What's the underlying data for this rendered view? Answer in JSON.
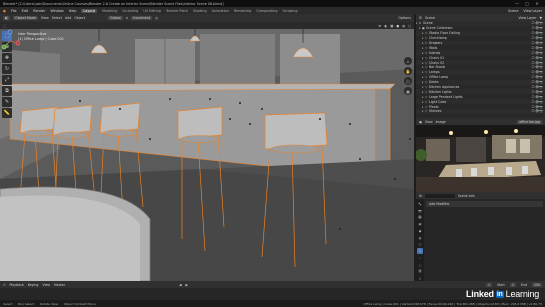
{
  "titlebar": {
    "title": "Blender* [C:\\Users\\user\\Documents\\Online Courses\\Blender 2.8 Create an Interior Scene\\Blender Scene Files\\Interior Scene 08.blend]",
    "minimize": "—",
    "maximize": "□",
    "close": "✕"
  },
  "menubar": {
    "menus": [
      "File",
      "Edit",
      "Render",
      "Window",
      "Help"
    ],
    "workspaces": [
      "Layout",
      "Modeling",
      "Sculpting",
      "UV Editing",
      "Texture Paint",
      "Shading",
      "Animation",
      "Rendering",
      "Compositing",
      "Scripting"
    ],
    "active_workspace": "Layout",
    "scene": "Scene",
    "view_layer": "View Layer"
  },
  "viewport_header": {
    "mode": "Object Mode",
    "menus": [
      "View",
      "Select",
      "Add",
      "Object"
    ],
    "transform": "Global",
    "snap": "Increment",
    "options": "Options"
  },
  "viewport_info": {
    "view": "User Perspective",
    "collection": "(1) Office Lamp | Cube.001"
  },
  "toolbar": {
    "tools": [
      "select-icon",
      "cursor-icon",
      "move-icon",
      "rotate-icon",
      "scale-icon",
      "transform-icon",
      "annotate-icon",
      "measure-icon"
    ]
  },
  "gizmo": {
    "x": "X",
    "y": "Y",
    "z": "Z"
  },
  "outliner": {
    "header_label": "Scene",
    "view_layer": "View Layer",
    "rows": [
      {
        "name": "Scene",
        "icon": "S",
        "color": "#d0d0d0"
      },
      {
        "name": "Scene Collection",
        "icon": "▣",
        "color": "#d0d0d0"
      },
      {
        "name": "Stadio Floor Ceiling",
        "icon": "▽",
        "color": "#e0a060"
      },
      {
        "name": "Checklamp",
        "icon": "▽",
        "color": "#e0a060"
      },
      {
        "name": "Drawers",
        "icon": "▽",
        "color": "#e0a060"
      },
      {
        "name": "Walls",
        "icon": "▽",
        "color": "#e0a060"
      },
      {
        "name": "Islands",
        "icon": "▽",
        "color": "#e0a060"
      },
      {
        "name": "Chairs 01",
        "icon": "▽",
        "color": "#e0a060"
      },
      {
        "name": "Chairs 02",
        "icon": "▽",
        "color": "#e0a060"
      },
      {
        "name": "Bar Stools",
        "icon": "▽",
        "color": "#e0a060"
      },
      {
        "name": "Lamps",
        "icon": "▽",
        "color": "#e0a060"
      },
      {
        "name": "Office Lamp",
        "icon": "▽",
        "color": "#e0a060"
      },
      {
        "name": "Desks",
        "icon": "▽",
        "color": "#e0a060"
      },
      {
        "name": "Kitchen Appliances",
        "icon": "▽",
        "color": "#e0a060"
      },
      {
        "name": "Kitchen Lights",
        "icon": "▽",
        "color": "#e0a060"
      },
      {
        "name": "Large Pendant Lights",
        "icon": "▽",
        "color": "#e0a060"
      },
      {
        "name": "Light Cube",
        "icon": "▽",
        "color": "#e0a060"
      },
      {
        "name": "Plants",
        "icon": "▽",
        "color": "#e0a060"
      },
      {
        "name": "Shelves",
        "icon": "▽",
        "color": "#e0a060"
      }
    ]
  },
  "preview_header": {
    "menus": [
      "View",
      "Image"
    ],
    "image_name": "office bar.jpg"
  },
  "properties_header": {
    "search_placeholder": "",
    "object_label": "Scene Info"
  },
  "properties": {
    "panel": "Add Modifier",
    "tabs": [
      "tool-icon",
      "render-icon",
      "output-icon",
      "view-layer-icon",
      "scene-icon",
      "world-icon",
      "object-icon",
      "modifier-icon",
      "particles-icon",
      "physics-icon",
      "constraints-icon",
      "data-icon",
      "material-icon"
    ]
  },
  "timeline": {
    "menus": [
      "Playback",
      "Keying",
      "View",
      "Marker"
    ],
    "current_frame": "1",
    "start_label": "Start",
    "start": "1",
    "end_label": "End",
    "end": "250"
  },
  "statusbar": {
    "items": [
      "Select",
      "Box Select",
      "Rotate View",
      "Object Context Menu"
    ],
    "stats": "Office Lamp | Cube.001 | Verts:0/198,578 | Faces:0/190,240 | Tris:381,488 | Objects:1/168 | Mem: 205.2 MiB | v2.80.75"
  },
  "watermark": {
    "brand": "Linked",
    "badge": "in",
    "suffix": "Learning"
  },
  "colors": {
    "accent": "#4772b3",
    "selection_outline": "#e8822a",
    "viewport_bg": "#3f3f3f"
  }
}
